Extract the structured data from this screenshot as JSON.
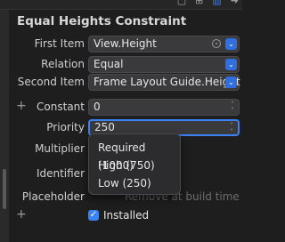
{
  "title": "Equal Heights Constraint",
  "first_item": {
    "label": "First Item",
    "value": "View.Height"
  },
  "relation": {
    "label": "Relation",
    "value": "Equal"
  },
  "second_item": {
    "label": "Second Item",
    "value": "Frame Layout Guide.Height"
  },
  "constant": {
    "label": "Constant",
    "value": "0"
  },
  "priority": {
    "label": "Priority",
    "value": "250",
    "options": [
      "Required (1000)",
      "High (750)",
      "Low (250)"
    ]
  },
  "multiplier": {
    "label": "Multiplier"
  },
  "identifier": {
    "label": "Identifier"
  },
  "placeholder": {
    "label": "Placeholder",
    "partial_text": "Remove at build time"
  },
  "installed": {
    "label": "Installed",
    "checked": true
  },
  "colors": {
    "accent": "#3b82f6",
    "background": "#1e1e1e",
    "field": "#3a3a3c"
  }
}
